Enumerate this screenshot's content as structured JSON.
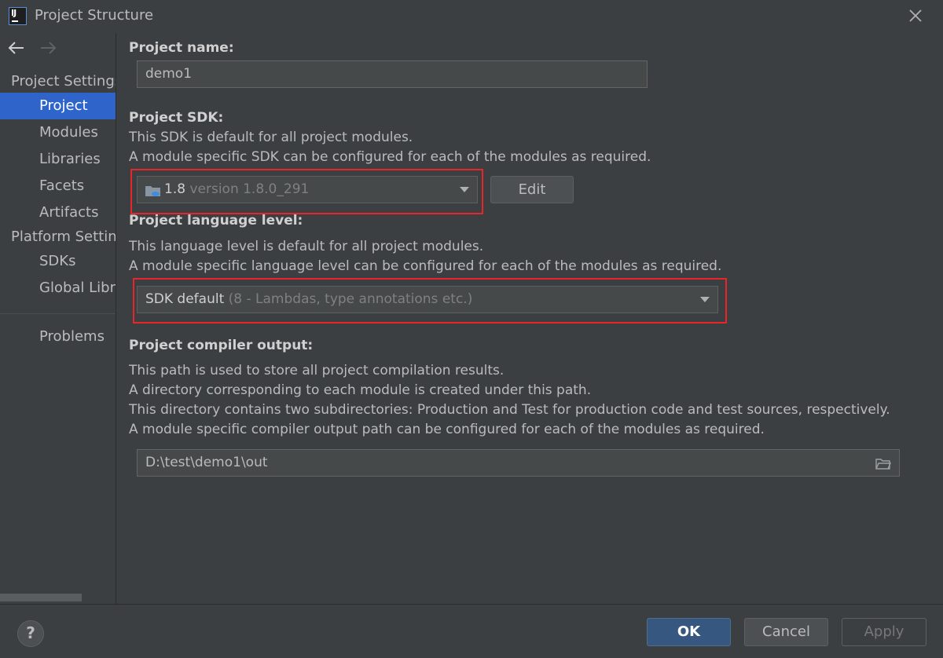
{
  "window": {
    "title": "Project Structure"
  },
  "sidebar": {
    "sections": [
      {
        "heading": "Project Settings",
        "items": [
          {
            "label": "Project",
            "selected": true
          },
          {
            "label": "Modules"
          },
          {
            "label": "Libraries"
          },
          {
            "label": "Facets"
          },
          {
            "label": "Artifacts"
          }
        ]
      },
      {
        "heading": "Platform Settings",
        "items": [
          {
            "label": "SDKs"
          },
          {
            "label": "Global Libraries"
          }
        ]
      }
    ],
    "problems": "Problems"
  },
  "project_name": {
    "label": "Project name:",
    "value": "demo1"
  },
  "project_sdk": {
    "label": "Project SDK:",
    "desc1": "This SDK is default for all project modules.",
    "desc2": "A module specific SDK can be configured for each of the modules as required.",
    "selected_name": "1.8",
    "selected_version": "version 1.8.0_291",
    "edit_label": "Edit"
  },
  "language_level": {
    "label": "Project language level:",
    "desc1": "This language level is default for all project modules.",
    "desc2": "A module specific language level can be configured for each of the modules as required.",
    "selected_name": "SDK default",
    "selected_detail": "(8 - Lambdas, type annotations etc.)"
  },
  "compiler_output": {
    "label": "Project compiler output:",
    "desc1": "This path is used to store all project compilation results.",
    "desc2": "A directory corresponding to each module is created under this path.",
    "desc3": "This directory contains two subdirectories: Production and Test for production code and test sources, respectively.",
    "desc4": "A module specific compiler output path can be configured for each of the modules as required.",
    "path": "D:\\test\\demo1\\out"
  },
  "buttons": {
    "ok": "OK",
    "cancel": "Cancel",
    "apply": "Apply",
    "help": "?"
  },
  "colors": {
    "accent": "#2f65ca",
    "highlight": "#e8262a",
    "ok_button": "#365880"
  }
}
